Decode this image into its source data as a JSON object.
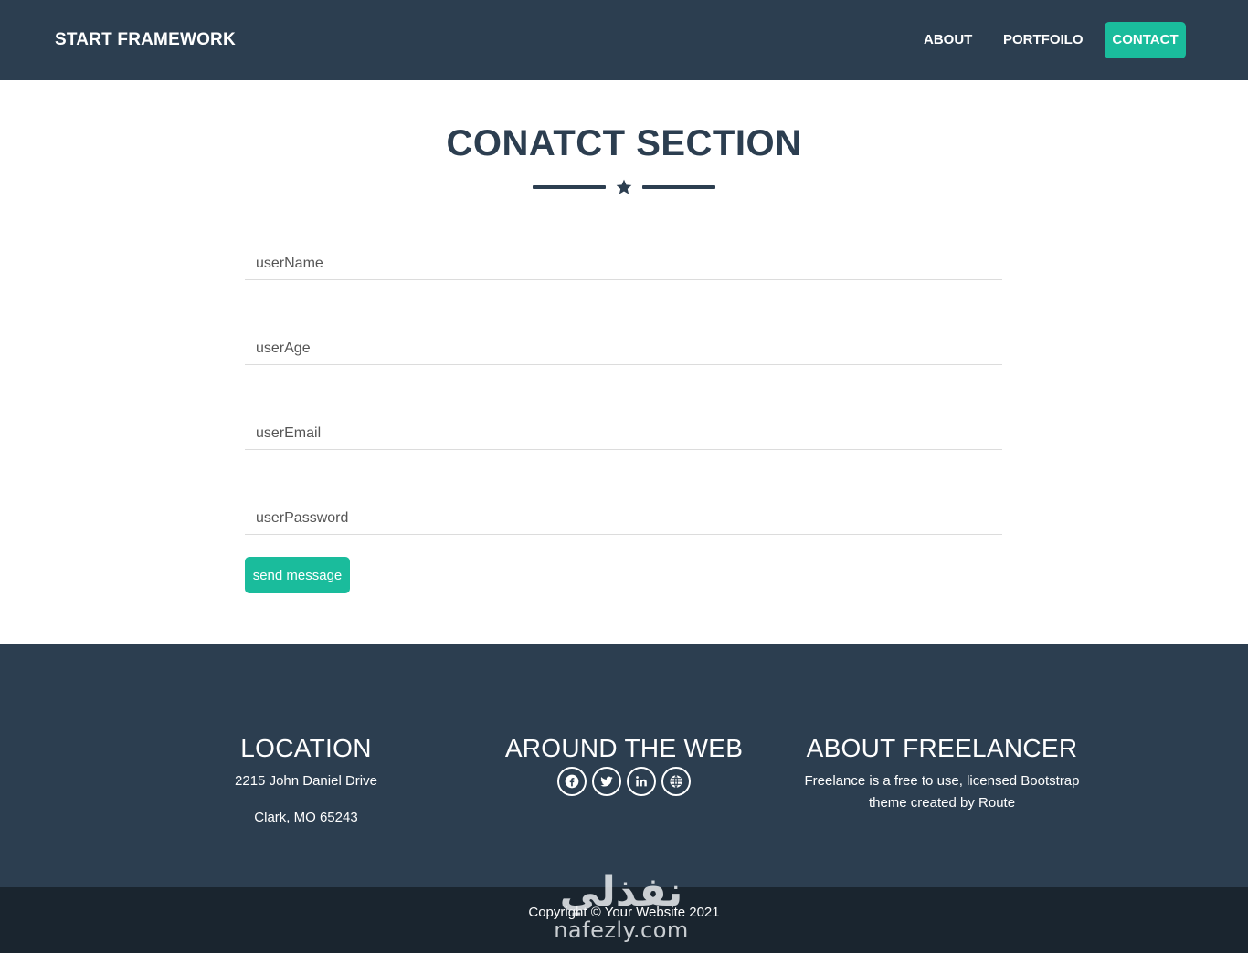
{
  "navbar": {
    "brand": "START FRAMEWORK",
    "links": [
      {
        "label": "ABOUT"
      },
      {
        "label": "PORTFOILO"
      },
      {
        "label": "CONTACT"
      }
    ]
  },
  "contact": {
    "title": "CONATCT SECTION",
    "fields": [
      {
        "placeholder": "userName",
        "value": ""
      },
      {
        "placeholder": "userAge",
        "value": ""
      },
      {
        "placeholder": "userEmail",
        "value": ""
      },
      {
        "placeholder": "userPassword",
        "value": ""
      }
    ],
    "submit_label": "send message"
  },
  "footer": {
    "location": {
      "heading": "LOCATION",
      "line1": "2215 John Daniel Drive",
      "line2": "Clark, MO 65243"
    },
    "around_web": {
      "heading": "AROUND THE WEB",
      "icons": [
        "facebook-icon",
        "twitter-icon",
        "linkedin-icon",
        "globe-icon"
      ]
    },
    "about": {
      "heading": "ABOUT FREELANCER",
      "text_line1": "Freelance is a free to use, licensed Bootstrap",
      "text_line2": "theme created by Route"
    },
    "copyright": "Copyright © Your Website 2021"
  },
  "watermark": {
    "arabic": "نفذلي",
    "latin": "nafezly.com"
  },
  "colors": {
    "primary_dark": "#2c3e50",
    "accent": "#1abc9c",
    "copyright_bg": "#1a252f",
    "white": "#ffffff"
  }
}
